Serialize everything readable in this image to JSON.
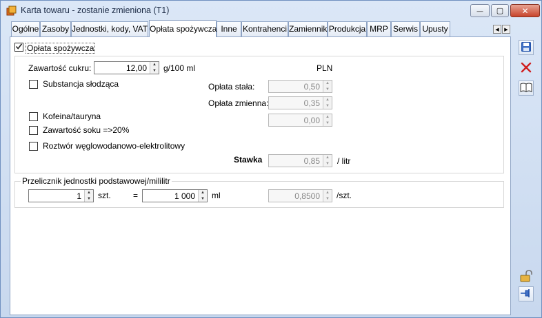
{
  "window": {
    "title": "Karta towaru - zostanie zmieniona (T1)",
    "min_glyph": "—",
    "max_glyph": "▢",
    "close_glyph": "✕"
  },
  "tabs": [
    {
      "label": "Ogólne"
    },
    {
      "label": "Zasoby"
    },
    {
      "label": "Jednostki, kody, VAT"
    },
    {
      "label": "Opłata spożywcza"
    },
    {
      "label": "Inne"
    },
    {
      "label": "Kontrahenci"
    },
    {
      "label": "Zamienniki"
    },
    {
      "label": "Produkcja"
    },
    {
      "label": "MRP"
    },
    {
      "label": "Serwis"
    },
    {
      "label": "Upusty"
    }
  ],
  "active_tab": "Opłata spożywcza",
  "fee": {
    "enabled_label": "Opłata spożywcza",
    "enabled_checked": true,
    "sugar_label": "Zawartość cukru:",
    "sugar_value": "12,00",
    "sugar_unit": "g/100 ml",
    "currency": "PLN",
    "sweetener_label": "Substancja słodząca",
    "fixed_fee_label": "Opłata stała:",
    "fixed_fee_value": "0,50",
    "variable_fee_label": "Opłata zmienna:",
    "variable_fee_value": "0,35",
    "extra_value": "0,00",
    "caffeine_label": "Kofeina/tauryna",
    "juice_label": "Zawartość soku =>20%",
    "electrolyte_label": "Roztwór węglowodanowo-elektrolitowy",
    "rate_label": "Stawka",
    "rate_value": "0,85",
    "rate_unit": "/ litr"
  },
  "converter": {
    "legend": "Przelicznik jednostki podstawowej/mililitr",
    "qty_value": "1",
    "qty_unit": "szt.",
    "equals": "=",
    "ml_value": "1 000",
    "ml_unit": "ml",
    "ratio_value": "0,8500",
    "ratio_unit": "/szt."
  },
  "spin_glyphs": {
    "up": "▲",
    "down": "▼"
  },
  "colors": {
    "window_bg": "#c8d8ee",
    "accent_blue": "#1f4fa8",
    "delete_red": "#d02020"
  }
}
